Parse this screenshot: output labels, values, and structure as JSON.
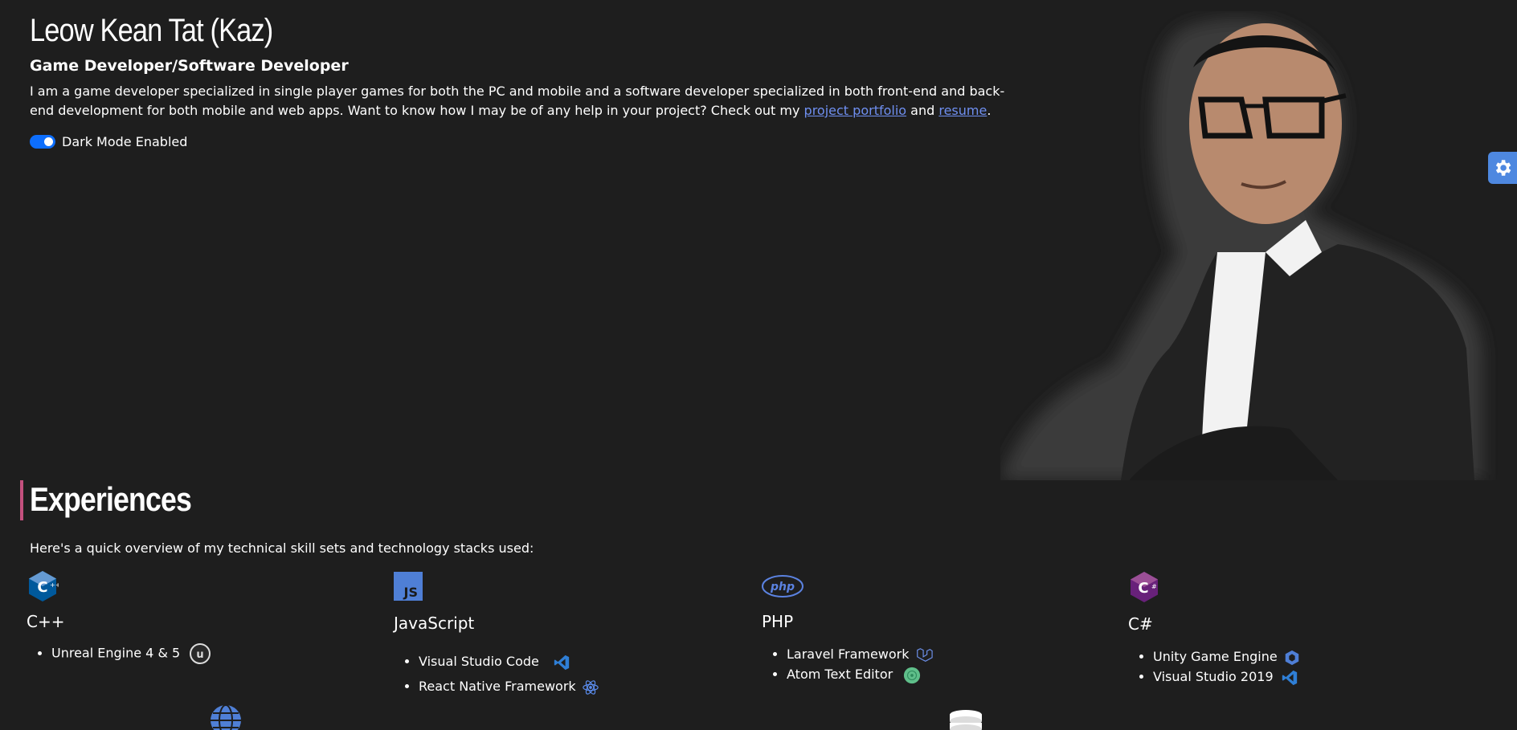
{
  "header": {
    "name": "Leow Kean Tat (Kaz)",
    "role": "Game Developer/Software Developer",
    "intro_text": "I am a game developer specialized in single player games for both the PC and mobile and a software developer specialized in both front-end and back-end development for both mobile and web apps. Want to know how I may be of any help in your project? Check out my ",
    "portfolio_link": "project portfolio",
    "and_text": " and ",
    "resume_link": "resume",
    "period": ".",
    "dark_mode_label": "Dark Mode Enabled",
    "dark_mode_on": true
  },
  "colors": {
    "background": "#1e1e1e",
    "link": "#6f8ff0",
    "toggle": "#0d6efd",
    "accent_bar": "#c4507e",
    "settings_button": "#4e88e0"
  },
  "experiences": {
    "title": "Experiences",
    "subtitle": "Here's a quick overview of my technical skill sets and technology stacks used:",
    "skills": [
      {
        "name": "C++",
        "icon": "cpp-icon",
        "tools": [
          {
            "label": "Unreal Engine 4 & 5",
            "icon": "unreal-engine-icon"
          }
        ]
      },
      {
        "name": "JavaScript",
        "icon": "javascript-icon",
        "tools": [
          {
            "label": "Visual Studio Code",
            "icon": "vscode-icon"
          },
          {
            "label": "React Native Framework",
            "icon": "react-icon"
          }
        ]
      },
      {
        "name": "PHP",
        "icon": "php-icon",
        "tools": [
          {
            "label": "Laravel Framework",
            "icon": "laravel-icon"
          },
          {
            "label": "Atom Text Editor",
            "icon": "atom-icon"
          }
        ]
      },
      {
        "name": "C#",
        "icon": "csharp-icon",
        "tools": [
          {
            "label": "Unity Game Engine",
            "icon": "unity-icon"
          },
          {
            "label": "Visual Studio 2019",
            "icon": "visual-studio-icon"
          }
        ]
      }
    ]
  }
}
